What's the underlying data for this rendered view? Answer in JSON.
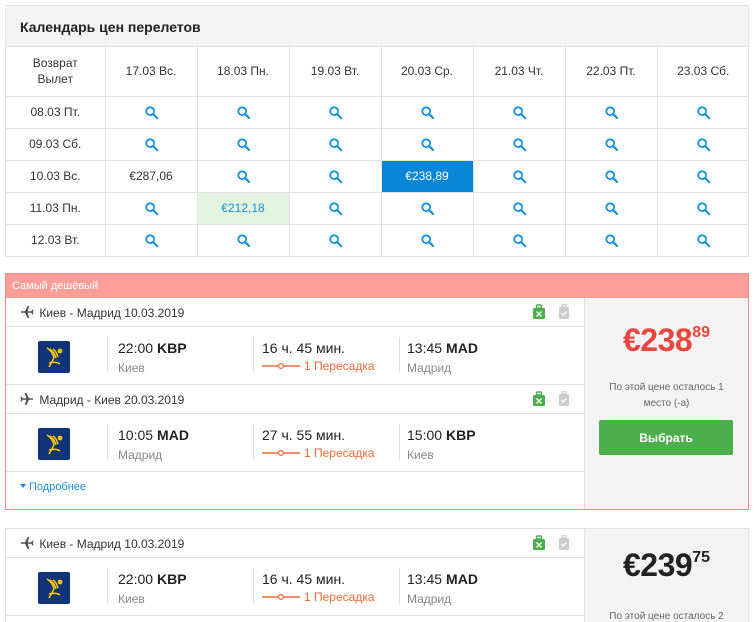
{
  "calendar": {
    "title": "Календарь цен перелетов",
    "corner_top": "Возврат",
    "corner_bottom": "Вылет",
    "return_dates": [
      "17.03 Вс.",
      "18.03 Пн.",
      "19.03 Вт.",
      "20.03 Ср.",
      "21.03 Чт.",
      "22.03 Пт.",
      "23.03 Сб."
    ],
    "rows": [
      {
        "depart": "08.03 Пт.",
        "cells": [
          "",
          "",
          "",
          "",
          "",
          "",
          ""
        ]
      },
      {
        "depart": "09.03 Сб.",
        "cells": [
          "",
          "",
          "",
          "",
          "",
          "",
          ""
        ]
      },
      {
        "depart": "10.03 Вс.",
        "cells": [
          "€287,06",
          "",
          "",
          "€238,89",
          "",
          "",
          ""
        ]
      },
      {
        "depart": "11.03 Пн.",
        "cells": [
          "",
          "€212,18",
          "",
          "",
          "",
          "",
          ""
        ]
      },
      {
        "depart": "12.03 Вт.",
        "cells": [
          "",
          "",
          "",
          "",
          "",
          "",
          ""
        ]
      }
    ],
    "icon": "search-icon",
    "accent_color": "#0a86d6",
    "cheap_color": "#e2f3df"
  },
  "offers": [
    {
      "badge": "Самый дешёвый",
      "segments": [
        {
          "route": "Киев - Мадрид 10.03.2019",
          "dep_time": "22:00",
          "dep_code": "KBP",
          "dep_city": "Киев",
          "duration": "16 ч. 45 мин.",
          "stops": "1 Пересадка",
          "arr_time": "13:45",
          "arr_code": "MAD",
          "arr_city": "Мадрид"
        },
        {
          "route": "Мадрид - Киев 20.03.2019",
          "dep_time": "10:05",
          "dep_code": "MAD",
          "dep_city": "Мадрид",
          "duration": "27 ч. 55 мин.",
          "stops": "1 Пересадка",
          "arr_time": "15:00",
          "arr_code": "KBP",
          "arr_city": "Киев"
        }
      ],
      "more": "Подробнее",
      "price_int": "€238",
      "price_dec": "89",
      "seats_left": "По этой цене осталось 1 место (-а)",
      "select_label": "Выбрать"
    },
    {
      "segments": [
        {
          "route": "Киев - Мадрид 10.03.2019",
          "dep_time": "22:00",
          "dep_code": "KBP",
          "dep_city": "Киев",
          "duration": "16 ч. 45 мин.",
          "stops": "1 Пересадка",
          "arr_time": "13:45",
          "arr_code": "MAD",
          "arr_city": "Мадрид"
        }
      ],
      "price_int": "€239",
      "price_dec": "75",
      "seats_left": "По этой цене осталось 2"
    }
  ],
  "colors": {
    "best_price": "#e8473f",
    "badge": "#fb9d98",
    "select_button": "#4cae4c",
    "stops": "#f26a36",
    "link": "#1890d6"
  }
}
